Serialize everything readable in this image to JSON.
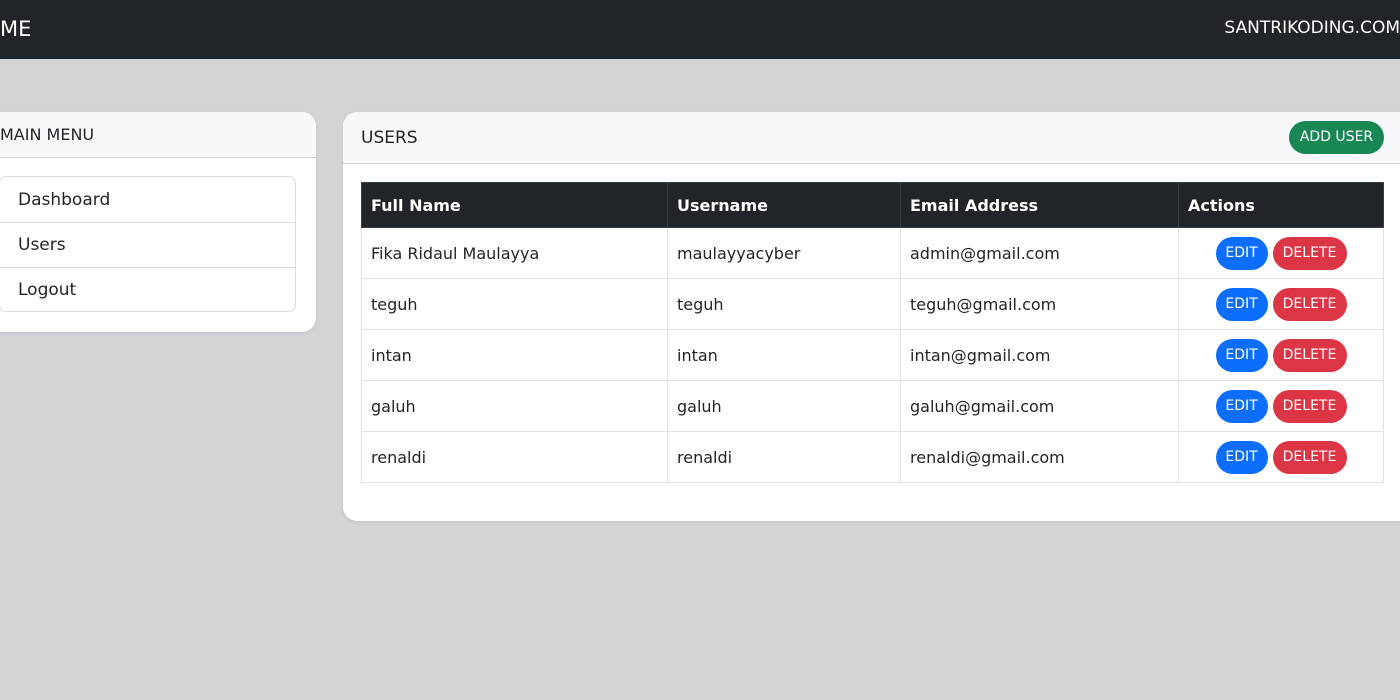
{
  "navbar": {
    "brand": "ME",
    "site_link": "SANTRIKODING.COM"
  },
  "sidebar": {
    "title": "MAIN MENU",
    "items": [
      {
        "label": "Dashboard"
      },
      {
        "label": "Users"
      },
      {
        "label": "Logout"
      }
    ]
  },
  "users_panel": {
    "title": "USERS",
    "add_button_label": "ADD USER",
    "columns": [
      "Full Name",
      "Username",
      "Email Address",
      "Actions"
    ],
    "edit_label": "EDIT",
    "delete_label": "DELETE",
    "rows": [
      {
        "full_name": "Fika Ridaul Maulayya",
        "username": "maulayyacyber",
        "email": "admin@gmail.com"
      },
      {
        "full_name": "teguh",
        "username": "teguh",
        "email": "teguh@gmail.com"
      },
      {
        "full_name": "intan",
        "username": "intan",
        "email": "intan@gmail.com"
      },
      {
        "full_name": "galuh",
        "username": "galuh",
        "email": "galuh@gmail.com"
      },
      {
        "full_name": "renaldi",
        "username": "renaldi",
        "email": "renaldi@gmail.com"
      }
    ]
  },
  "colors": {
    "navbar_bg": "#212529",
    "page_bg": "#d4d3d6",
    "add_button": "#198754",
    "edit_button": "#0d6efd",
    "delete_button": "#dc3545"
  }
}
